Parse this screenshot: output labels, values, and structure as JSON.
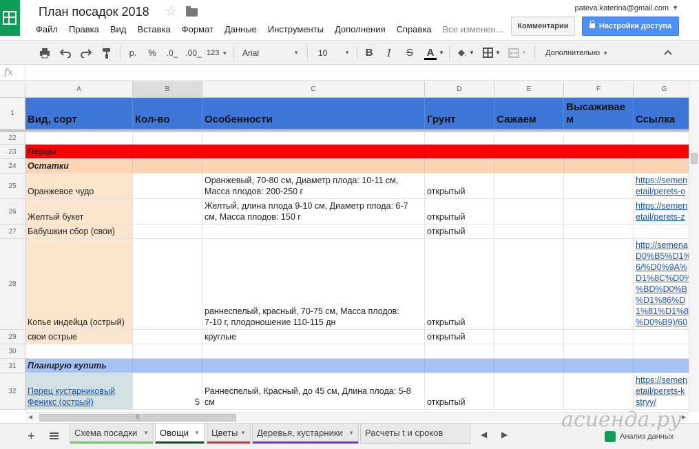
{
  "app": {
    "doc_title": "План посадок 2018",
    "user_email": "pateva.katerina@gmail.com",
    "save_status": "Все изменен...",
    "comments_label": "Комментарии",
    "share_label": "Настройки доступа"
  },
  "menu": [
    "Файл",
    "Правка",
    "Вид",
    "Вставка",
    "Формат",
    "Данные",
    "Инструменты",
    "Дополнения",
    "Справка"
  ],
  "toolbar": {
    "currency": "р.",
    "percent": "%",
    "dec_less": ".0_",
    "dec_more": ".00_",
    "format_more": "123",
    "font": "Arial",
    "font_size": "10",
    "bold": "B",
    "italic": "I",
    "strike": "S",
    "text_color": "A",
    "more": "Дополнительно"
  },
  "formula": {
    "fx": "fx",
    "value": ""
  },
  "columns": [
    {
      "letter": "A"
    },
    {
      "letter": "B"
    },
    {
      "letter": "C"
    },
    {
      "letter": "D"
    },
    {
      "letter": "E"
    },
    {
      "letter": "F"
    },
    {
      "letter": "G"
    }
  ],
  "header_row": {
    "num": "1",
    "cells": [
      "Вид, сорт",
      "Кол-во",
      "Особенности",
      "Грунт",
      "Сажаем",
      "Высаживае\nм",
      "Ссылка"
    ]
  },
  "rows": [
    {
      "num": "22",
      "cells": [
        "",
        "",
        "",
        "",
        "",
        "",
        ""
      ]
    },
    {
      "num": "23",
      "cells": [
        "Перцы",
        "",
        "",
        "",
        "",
        "",
        ""
      ]
    },
    {
      "num": "24",
      "cells": [
        "Остатки",
        "",
        "",
        "",
        "",
        "",
        ""
      ]
    },
    {
      "num": "25",
      "cells": [
        "Оранжевое чудо",
        "",
        "Оранжевый, 70-80 см, Диаметр плода: 10-11 см,\nМасса плодов: 200-250 г",
        "открытый",
        "",
        "",
        "https://semen\netail/perets-o"
      ]
    },
    {
      "num": "26",
      "cells": [
        "Желтый букет",
        "",
        "Желтый, длина плода 9-10 см, Диаметр плода: 6-7\nсм, Масса плодов: 150 г",
        "открытый",
        "",
        "",
        "https://semen\netail/perets-z"
      ]
    },
    {
      "num": "27",
      "cells": [
        "Бабушкин сбор (свои)",
        "",
        "",
        "открытый",
        "",
        "",
        ""
      ]
    },
    {
      "num": "28",
      "cells": [
        "Копье индейца (острый)",
        "",
        "раннеспелый, красный, 70-75 см, Масса плодов:\n7-10 г, плодоношение 110-115 дн",
        "открытый",
        "",
        "",
        "http://semena\nD0%B5%D1%\n6/%D0%9A%\nD1%8C%D0%\n%BD%D0%B\n%D1%86%D\n1%81%D1%8\n%D0%B9)/60"
      ]
    },
    {
      "num": "29",
      "cells": [
        "свои острые",
        "",
        "круглые",
        "открытый",
        "",
        "",
        ""
      ]
    },
    {
      "num": "30",
      "cells": [
        "",
        "",
        "",
        "",
        "",
        "",
        ""
      ]
    },
    {
      "num": "31",
      "cells": [
        "Планирую купить",
        "",
        "",
        "",
        "",
        "",
        ""
      ]
    },
    {
      "num": "32",
      "cells": [
        "Перец кустарниковый\nФеникс (острый)",
        "5",
        "Раннеспелый, Красный, до 45 см, Длина плода: 5-8\nсм",
        "открытый",
        "",
        "",
        "https://semen\netail/perets-k\nstryy/"
      ]
    }
  ],
  "sheets": [
    {
      "name": "Схема посадки",
      "color": "#66dd55",
      "active": false
    },
    {
      "name": "Овощи",
      "color": "#0b5a2a",
      "active": true
    },
    {
      "name": "Цветы",
      "color": "#dd3333",
      "active": false
    },
    {
      "name": "Деревья, кустарники",
      "color": "#8833cc",
      "active": false
    },
    {
      "name": "Расчеты t и сроков посад",
      "color": "",
      "active": false
    }
  ],
  "explore_label": "Анализ данных",
  "watermark": "асиенда.ру",
  "colors": {
    "header_blue": "#3d78d8",
    "peppers_red": "#ff0000",
    "section_peach": "#fcd5b4",
    "row_peach": "#fce5cd",
    "plan_blue": "#a4c2f4",
    "plan_cell": "#d0e0e3",
    "share_blue": "#4d90fe",
    "brand_green": "#0f9d58"
  },
  "icons": [
    "sheets-logo-icon",
    "star-icon",
    "folder-icon",
    "print-icon",
    "undo-icon",
    "redo-icon",
    "paint-format-icon",
    "fill-color-icon",
    "borders-icon",
    "merge-icon",
    "collapse-icon",
    "add-sheet-icon",
    "all-sheets-icon",
    "explore-icon"
  ]
}
